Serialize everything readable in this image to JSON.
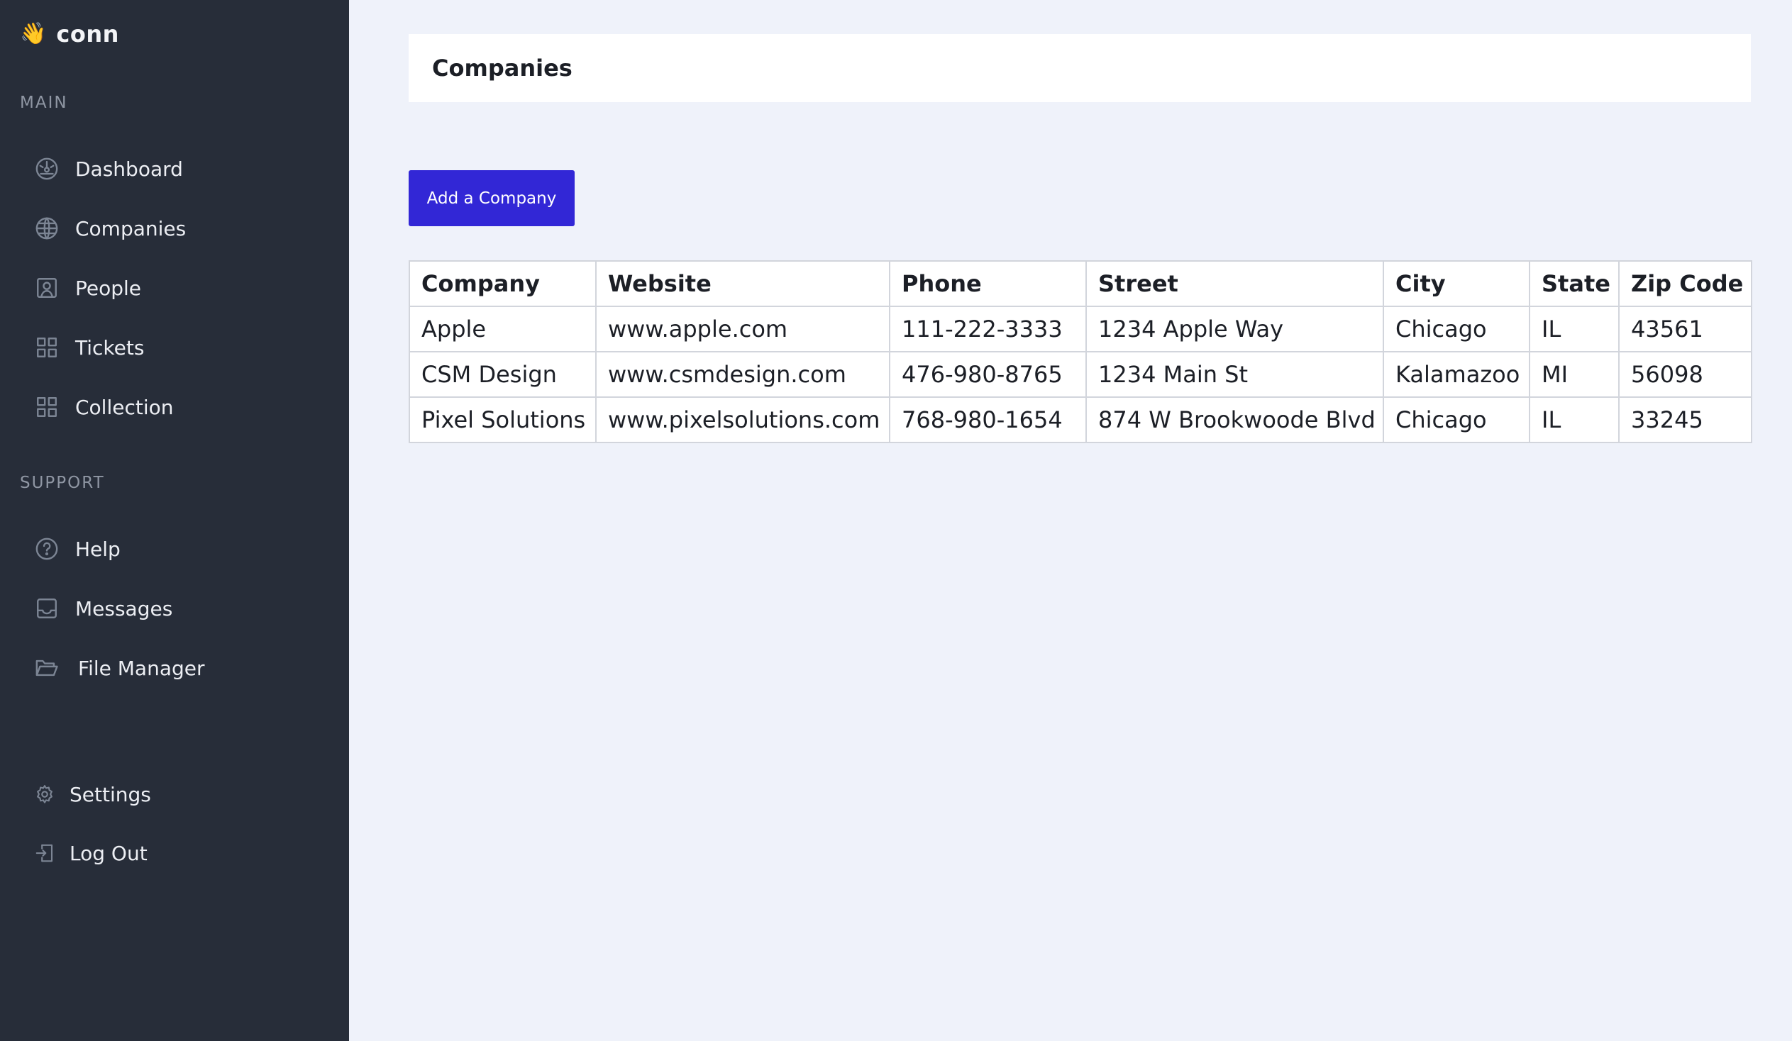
{
  "brand": {
    "emoji": "👋",
    "name": "conn"
  },
  "sidebar": {
    "main_label": "MAIN",
    "support_label": "SUPPORT",
    "main_items": [
      {
        "label": "Dashboard",
        "icon": "dashboard-icon"
      },
      {
        "label": "Companies",
        "icon": "globe-icon"
      },
      {
        "label": "People",
        "icon": "person-icon"
      },
      {
        "label": "Tickets",
        "icon": "grid-icon"
      },
      {
        "label": "Collection",
        "icon": "grid-icon"
      }
    ],
    "support_items": [
      {
        "label": "Help",
        "icon": "help-icon"
      },
      {
        "label": "Messages",
        "icon": "inbox-icon"
      },
      {
        "label": "File Manager",
        "icon": "folder-icon"
      }
    ],
    "bottom_items": [
      {
        "label": "Settings",
        "icon": "gear-icon"
      },
      {
        "label": "Log Out",
        "icon": "logout-icon"
      }
    ]
  },
  "header": {
    "title": "Companies"
  },
  "actions": {
    "add_label": "Add a Company"
  },
  "table": {
    "columns": [
      "Company",
      "Website",
      "Phone",
      "Street",
      "City",
      "State",
      "Zip Code"
    ],
    "rows": [
      [
        "Apple",
        "www.apple.com",
        "111-222-3333",
        "1234 Apple Way",
        "Chicago",
        "IL",
        "43561"
      ],
      [
        "CSM Design",
        "www.csmdesign.com",
        "476-980-8765",
        "1234 Main St",
        "Kalamazoo",
        "MI",
        "56098"
      ],
      [
        "Pixel Solutions",
        "www.pixelsolutions.com",
        "768-980-1654",
        "874 W Brookwoode Blvd",
        "Chicago",
        "IL",
        "33245"
      ]
    ]
  },
  "colors": {
    "sidebar_bg": "#272d39",
    "page_bg": "#eff2fa",
    "accent": "#3227d6"
  }
}
